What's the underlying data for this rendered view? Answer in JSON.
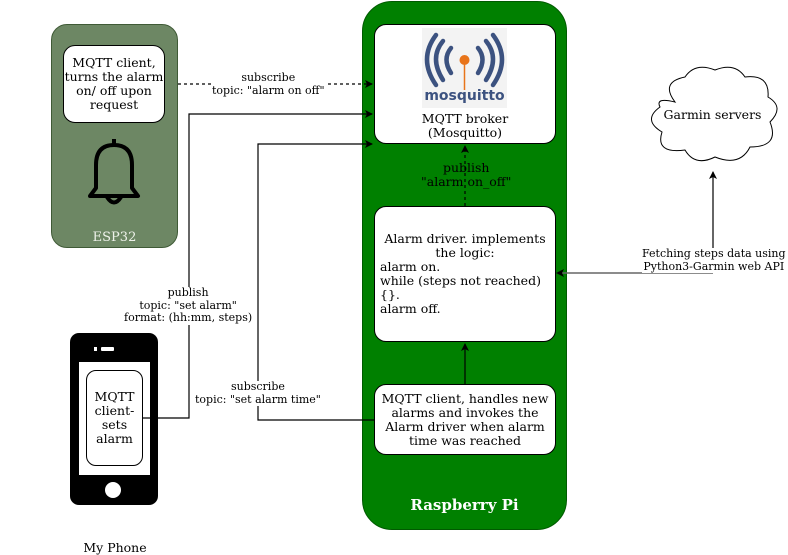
{
  "esp32": {
    "title": "ESP32",
    "client_text": "MQTT client,\nturns the alarm\non/ off upon\nrequest",
    "icon": "bell-icon"
  },
  "raspberry_pi": {
    "title": "Raspberry Pi",
    "broker": {
      "logo_text": "mosquitto",
      "text": "MQTT broker\n(Mosquitto)"
    },
    "driver": {
      "heading": "Alarm driver. implements\nthe logic:",
      "lines": [
        "alarm on.",
        "while (steps not reached){}.",
        "alarm off."
      ]
    },
    "handler_text": "MQTT client, handles new\nalarms and invokes the\nAlarm driver when alarm\ntime was reached"
  },
  "phone": {
    "title": "My Phone",
    "client_text": "MQTT\nclient-\nsets\nalarm"
  },
  "garmin": {
    "label": "Garmin servers"
  },
  "edges": {
    "subscribe_alarm_on_off": "subscribe\ntopic: \"alarm on off\"",
    "publish_set_alarm": "publish\ntopic: \"set alarm\"\nformat: (hh:mm, steps)",
    "subscribe_set_alarm_time": "subscribe\ntopic: \"set alarm time\"",
    "publish_alarm_on_off": "publish\n\"alarm on_off\"",
    "fetch_steps": "Fetching steps data using\nPython3-Garmin web API"
  },
  "colors": {
    "esp32_fill": "#6d8764",
    "rpi_fill": "#008000",
    "mosquitto_blue": "#3c5280",
    "mosquitto_orange": "#e8741a"
  }
}
